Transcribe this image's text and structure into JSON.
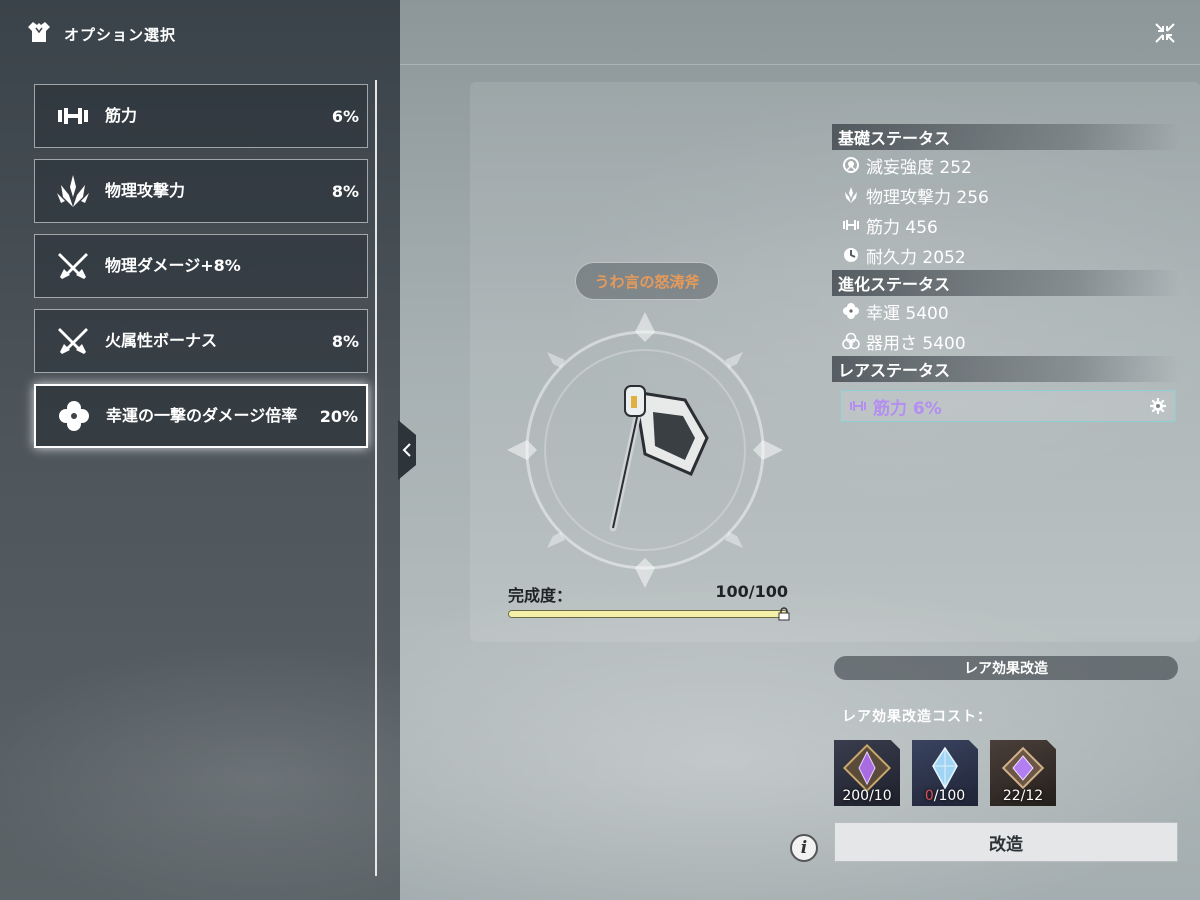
{
  "header": {
    "title": "オプション選択",
    "icon": "armor-icon"
  },
  "options": [
    {
      "label": "筋力",
      "value": "6%",
      "icon": "dumbbell-icon",
      "selected": false
    },
    {
      "label": "物理攻撃力",
      "value": "8%",
      "icon": "claw-icon",
      "selected": false
    },
    {
      "label": "物理ダメージ+8%",
      "value": "",
      "icon": "crossed-swords-icon",
      "selected": false
    },
    {
      "label": "火属性ボーナス",
      "value": "8%",
      "icon": "crossed-swords-icon",
      "selected": false
    },
    {
      "label": "幸運の一撃のダメージ倍率",
      "value": "20%",
      "icon": "clover-icon",
      "selected": true
    }
  ],
  "weapon": {
    "name": "うわ言の怒涛斧",
    "completion_label": "完成度：",
    "completion_value": "100/100",
    "completion_fraction": 1.0
  },
  "stats": {
    "basic_title": "基礎ステータス",
    "basic": [
      {
        "label": "滅妄強度 252",
        "icon": "psi-icon"
      },
      {
        "label": "物理攻撃力 256",
        "icon": "claw-icon"
      },
      {
        "label": "筋力 456",
        "icon": "dumbbell-icon"
      },
      {
        "label": "耐久力 2052",
        "icon": "shield-icon"
      }
    ],
    "evolution_title": "進化ステータス",
    "evolution": [
      {
        "label": "幸運 5400",
        "icon": "clover-icon"
      },
      {
        "label": "器用さ 5400",
        "icon": "dexterity-icon"
      }
    ],
    "rare_title": "レアステータス",
    "rare": {
      "label": "筋力 6%",
      "icon": "dumbbell-icon",
      "color": "#b48ef0"
    }
  },
  "modify": {
    "section_title": "レア効果改造",
    "cost_label": "レア効果改造コスト：",
    "costs": [
      {
        "count_zero": "",
        "count": "200/10",
        "icon": "purple-crystal-frame-icon"
      },
      {
        "count_zero": "0",
        "count": "/100",
        "icon": "blue-crystal-icon"
      },
      {
        "count_zero": "",
        "count": "22/12",
        "icon": "purple-gem-frame-icon"
      }
    ],
    "button_label": "改造",
    "info_label": "i"
  }
}
